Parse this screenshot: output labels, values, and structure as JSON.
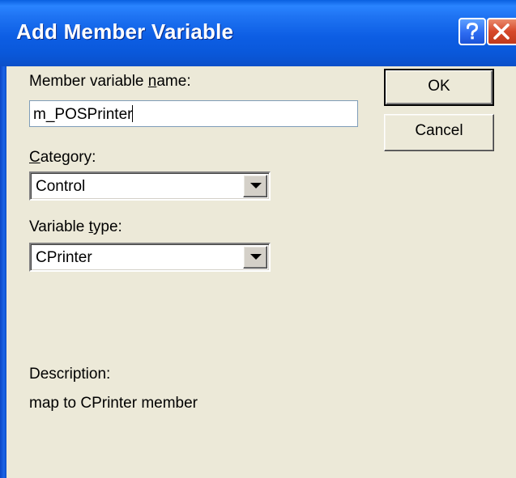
{
  "window": {
    "title": "Add Member Variable",
    "help_glyph": "?",
    "close_glyph": "X"
  },
  "form": {
    "member_name_label_pre": "Member variable ",
    "member_name_label_key": "n",
    "member_name_label_post": "ame:",
    "member_name_value": "m_POSPrinter",
    "category_label_key": "C",
    "category_label_post": "ategory:",
    "category_value": "Control",
    "variable_type_label_pre": "Variable ",
    "variable_type_label_key": "t",
    "variable_type_label_post": "ype:",
    "variable_type_value": "CPrinter",
    "description_label": "Description:",
    "description_text": "map to CPrinter member"
  },
  "buttons": {
    "ok_label": "OK",
    "cancel_label": "Cancel"
  },
  "colors": {
    "titlebar": "#0a5fe0",
    "dialog_bg": "#ece9d8",
    "close_red": "#d6482a"
  }
}
